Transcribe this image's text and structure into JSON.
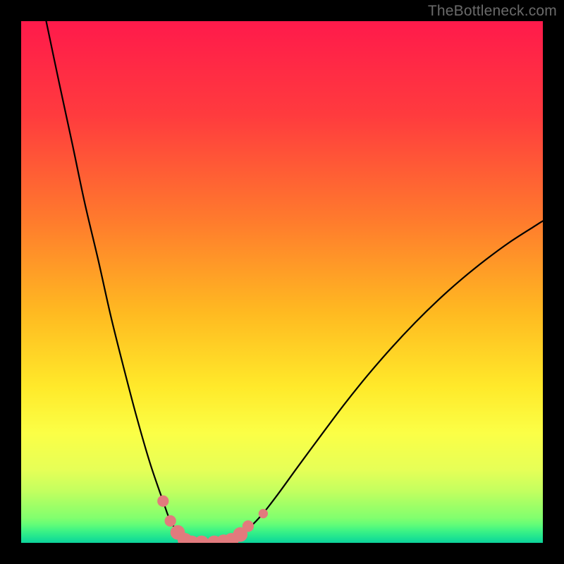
{
  "watermark": "TheBottleneck.com",
  "chart_data": {
    "type": "line",
    "title": "",
    "xlabel": "",
    "ylabel": "",
    "xlim": [
      0,
      100
    ],
    "ylim": [
      0,
      100
    ],
    "note": "V-shaped bottleneck curve over a vertical red→yellow→green gradient. Values estimated from pixels; no axes/ticks are shown in the source image.",
    "series": [
      {
        "name": "bottleneck-curve",
        "x": [
          4.8,
          7.3,
          9.8,
          12.2,
          14.8,
          17.2,
          19.7,
          22.2,
          24.7,
          27.2,
          28.6,
          30.2,
          31.4,
          32.7,
          34.6,
          37.0,
          40.3,
          42.7,
          45.9,
          49.2,
          52.9,
          57.4,
          61.9,
          66.4,
          71.0,
          75.5,
          80.0,
          84.5,
          89.1,
          93.6,
          98.1,
          100.0
        ],
        "y": [
          100.0,
          88.1,
          76.5,
          65.1,
          54.1,
          43.4,
          33.4,
          23.9,
          15.3,
          8.0,
          4.2,
          1.9,
          0.5,
          0.0,
          0.0,
          0.0,
          0.5,
          2.0,
          5.1,
          9.3,
          14.4,
          20.5,
          26.5,
          32.1,
          37.4,
          42.2,
          46.6,
          50.6,
          54.3,
          57.6,
          60.5,
          61.7
        ]
      }
    ],
    "markers": {
      "name": "highlight-dots",
      "color": "#e27a7d",
      "points": [
        {
          "x": 27.2,
          "y": 8.0,
          "r": 1.1
        },
        {
          "x": 28.6,
          "y": 4.2,
          "r": 1.1
        },
        {
          "x": 30.0,
          "y": 2.0,
          "r": 1.4
        },
        {
          "x": 31.4,
          "y": 0.5,
          "r": 1.4
        },
        {
          "x": 32.7,
          "y": 0.0,
          "r": 1.4
        },
        {
          "x": 34.6,
          "y": 0.0,
          "r": 1.4
        },
        {
          "x": 37.0,
          "y": 0.0,
          "r": 1.4
        },
        {
          "x": 38.8,
          "y": 0.2,
          "r": 1.4
        },
        {
          "x": 40.3,
          "y": 0.5,
          "r": 1.4
        },
        {
          "x": 42.0,
          "y": 1.6,
          "r": 1.4
        },
        {
          "x": 43.5,
          "y": 3.2,
          "r": 1.1
        },
        {
          "x": 46.4,
          "y": 5.6,
          "r": 0.9
        }
      ]
    },
    "gradient_stops": [
      {
        "pct": 0,
        "color": "#ff1a4b"
      },
      {
        "pct": 18,
        "color": "#ff3b3e"
      },
      {
        "pct": 38,
        "color": "#ff7a2d"
      },
      {
        "pct": 56,
        "color": "#ffba21"
      },
      {
        "pct": 70,
        "color": "#ffe92a"
      },
      {
        "pct": 79,
        "color": "#fbff46"
      },
      {
        "pct": 86,
        "color": "#e6ff57"
      },
      {
        "pct": 90,
        "color": "#c4ff5f"
      },
      {
        "pct": 93,
        "color": "#9dff67"
      },
      {
        "pct": 95.2,
        "color": "#82ff6e"
      },
      {
        "pct": 96.5,
        "color": "#62fd78"
      },
      {
        "pct": 97.5,
        "color": "#43f583"
      },
      {
        "pct": 98.3,
        "color": "#2eec8a"
      },
      {
        "pct": 99.0,
        "color": "#1fe391"
      },
      {
        "pct": 99.5,
        "color": "#14db96"
      },
      {
        "pct": 100,
        "color": "#0ed39b"
      }
    ]
  }
}
